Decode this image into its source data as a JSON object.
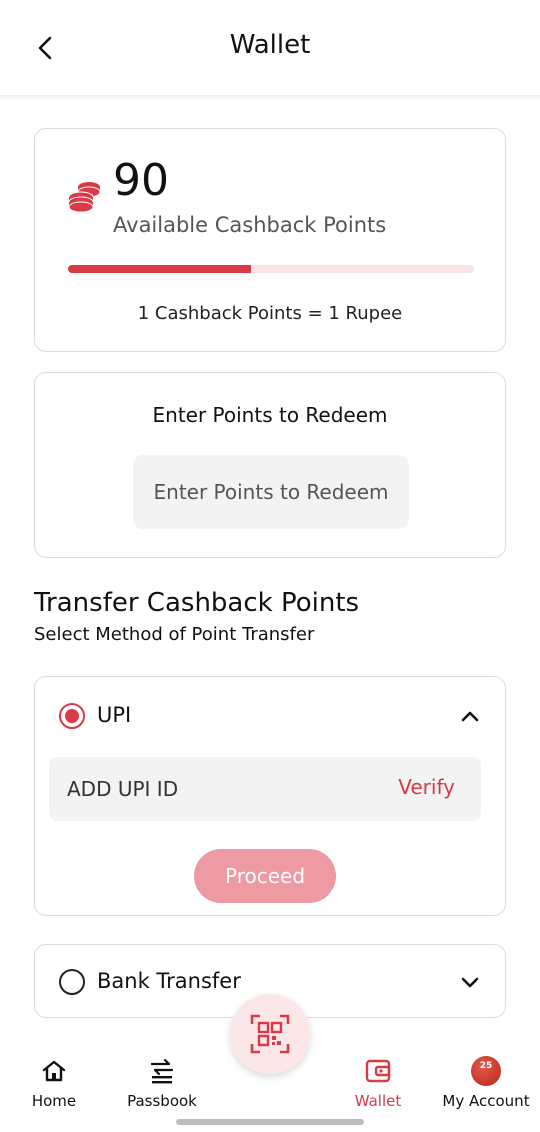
{
  "header": {
    "title": "Wallet",
    "back_icon": "chevron-left-icon"
  },
  "cashback": {
    "points": "90",
    "label": "Available Cashback Points",
    "progress_fraction": 0.45,
    "rate": "1 Cashback Points = 1 Rupee",
    "icon": "coins-icon"
  },
  "redeem": {
    "title": "Enter Points to Redeem",
    "placeholder": "Enter Points to Redeem"
  },
  "transfer": {
    "title": "Transfer Cashback Points",
    "subtitle": "Select Method of Point Transfer",
    "methods": [
      {
        "label": "UPI",
        "selected": true,
        "expanded": true,
        "input_placeholder": "ADD UPI ID",
        "verify_label": "Verify",
        "proceed_label": "Proceed"
      },
      {
        "label": "Bank Transfer",
        "selected": false,
        "expanded": false
      }
    ]
  },
  "nav": {
    "items": [
      {
        "label": "Home",
        "icon": "home-icon"
      },
      {
        "label": "Passbook",
        "icon": "passbook-icon"
      },
      {
        "label": "Wallet",
        "icon": "wallet-icon",
        "active": true
      },
      {
        "label": "My Account",
        "icon": "avatar"
      }
    ],
    "fab_icon": "qr-scan-icon"
  },
  "colors": {
    "accent": "#d83a47",
    "accent_light": "#ee9aa2",
    "track": "#fbe3e5",
    "field_bg": "#f3f3f3"
  }
}
